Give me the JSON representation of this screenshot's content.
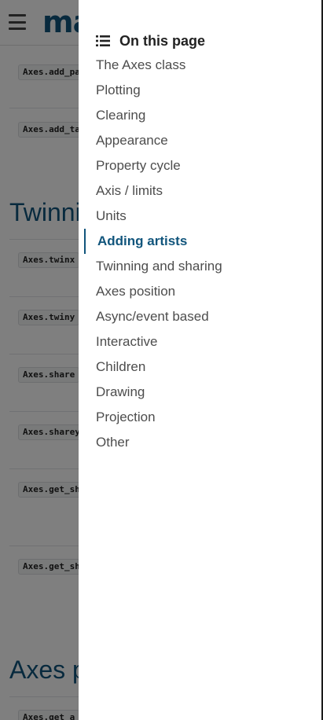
{
  "header": {
    "logo_text": "ma",
    "menu_icon": "hamburger-menu-icon"
  },
  "background": {
    "entries": [
      "Axes.add_pa",
      "Axes.add_ta",
      "Axes.twinx",
      "Axes.twiny",
      "Axes.share",
      "Axes.sharey",
      "Axes.get_sh",
      "Axes.get_sh",
      "Axes.get_a"
    ],
    "headings": [
      "Twinni",
      "Axes p"
    ]
  },
  "toc": {
    "icon": "list-icon",
    "title": "On this page",
    "items": [
      "The Axes class",
      "Plotting",
      "Clearing",
      "Appearance",
      "Property cycle",
      "Axis / limits",
      "Units",
      "Adding artists",
      "Twinning and sharing",
      "Axes position",
      "Async/event based",
      "Interactive",
      "Children",
      "Drawing",
      "Projection",
      "Other"
    ],
    "active_item": "Adding artists"
  }
}
